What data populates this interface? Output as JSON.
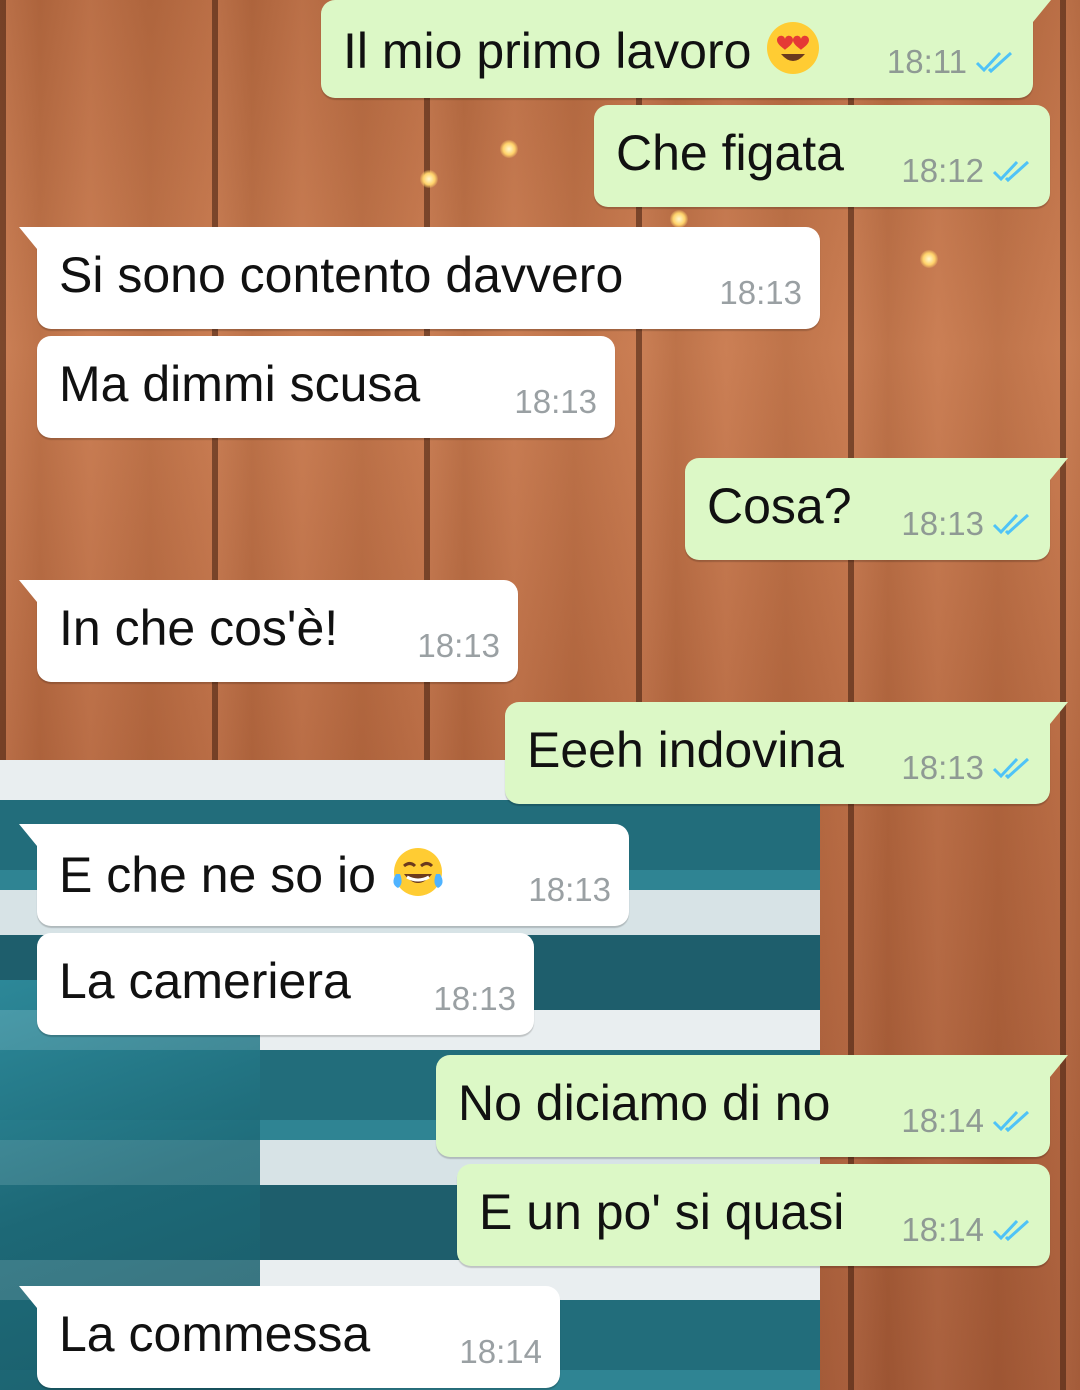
{
  "colors": {
    "outgoing_bubble": "#dcf8c6",
    "incoming_bubble": "#ffffff",
    "read_ticks": "#4fc3f7",
    "timestamp": "#8f9a94"
  },
  "messages": [
    {
      "dir": "out",
      "text": "Il mio primo lavoro",
      "emoji": "heart-eyes-emoji",
      "time": "18:11",
      "status": "read"
    },
    {
      "dir": "out",
      "text": "Che figata",
      "time": "18:12",
      "status": "read"
    },
    {
      "dir": "in",
      "text": "Si sono contento davvero",
      "time": "18:13"
    },
    {
      "dir": "in",
      "text": "Ma dimmi scusa",
      "time": "18:13"
    },
    {
      "dir": "out",
      "text": "Cosa?",
      "time": "18:13",
      "status": "read"
    },
    {
      "dir": "in",
      "text": "In che cos'è!",
      "time": "18:13"
    },
    {
      "dir": "out",
      "text": "Eeeh indovina",
      "time": "18:13",
      "status": "read"
    },
    {
      "dir": "in",
      "text": "E che ne so io",
      "emoji": "tears-of-joy-emoji",
      "time": "18:13"
    },
    {
      "dir": "in",
      "text": "La cameriera",
      "time": "18:13"
    },
    {
      "dir": "out",
      "text": "No diciamo di no",
      "time": "18:14",
      "status": "read"
    },
    {
      "dir": "out",
      "text": "E un po' si quasi",
      "time": "18:14",
      "status": "read"
    },
    {
      "dir": "in",
      "text": "La commessa",
      "time": "18:14"
    }
  ]
}
